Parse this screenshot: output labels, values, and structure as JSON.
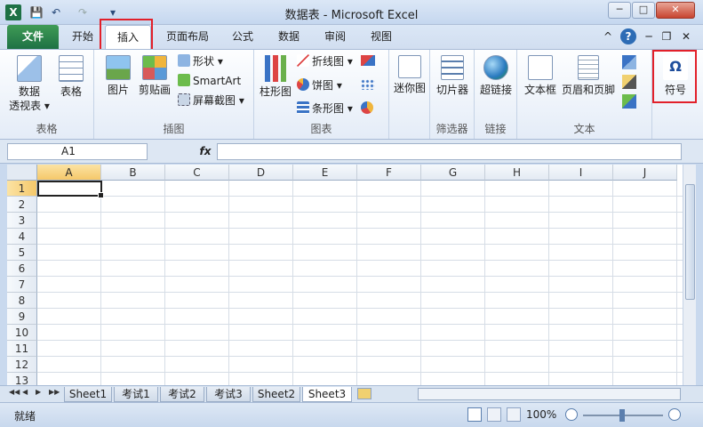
{
  "window": {
    "title": "数据表 - Microsoft Excel",
    "app_icon": "X",
    "quick_access": {
      "save": "💾",
      "undo": "↶",
      "redo": "↷",
      "customize": "▾"
    },
    "controls": {
      "minimize": "─",
      "maximize": "□",
      "close": "✕"
    }
  },
  "tabs": [
    {
      "label": "文件"
    },
    {
      "label": "开始"
    },
    {
      "label": "插入"
    },
    {
      "label": "页面布局"
    },
    {
      "label": "公式"
    },
    {
      "label": "数据"
    },
    {
      "label": "审阅"
    },
    {
      "label": "视图"
    }
  ],
  "tab_right_icons": {
    "collapse": "^",
    "help": "?",
    "min": "─",
    "restore": "❐",
    "close": "✕"
  },
  "ribbon": {
    "groups": [
      {
        "label": "表格",
        "buttons": [
          "数据透视表",
          "表格"
        ]
      },
      {
        "label": "插图",
        "buttons": [
          "图片",
          "剪贴画"
        ],
        "small": [
          "形状 ▾",
          "SmartArt",
          "屏幕截图 ▾"
        ]
      },
      {
        "label": "图表",
        "buttons": [
          "柱形图"
        ],
        "small": [
          "折线图 ▾",
          "饼图 ▾",
          "条形图 ▾"
        ]
      },
      {
        "label": "迷你图",
        "buttons": [
          "迷你图"
        ]
      },
      {
        "label": "筛选器",
        "buttons": [
          "切片器"
        ]
      },
      {
        "label": "链接",
        "buttons": [
          "超链接"
        ]
      },
      {
        "label": "文本",
        "buttons": [
          "文本框",
          "页眉和页脚"
        ]
      },
      {
        "label": "",
        "buttons": [
          "符号"
        ]
      }
    ],
    "pivot_line1": "数据",
    "pivot_line2": "透视表 ▾"
  },
  "formula_bar": {
    "name_box": "A1",
    "fx": "fx",
    "value": ""
  },
  "grid": {
    "columns": [
      "A",
      "B",
      "C",
      "D",
      "E",
      "F",
      "G",
      "H",
      "I",
      "J"
    ],
    "rows": [
      "1",
      "2",
      "3",
      "4",
      "5",
      "6",
      "7",
      "8",
      "9",
      "10",
      "11",
      "12",
      "13"
    ],
    "selected_cell": "A1"
  },
  "sheets": [
    "Sheet1",
    "考试1",
    "考试2",
    "考试3",
    "Sheet2",
    "Sheet3"
  ],
  "active_sheet": "Sheet3",
  "status": {
    "ready": "就绪",
    "zoom": "100%"
  },
  "colors": {
    "file_tab": "#1e7145",
    "highlight": "#e2202a",
    "selection": "#222222"
  }
}
